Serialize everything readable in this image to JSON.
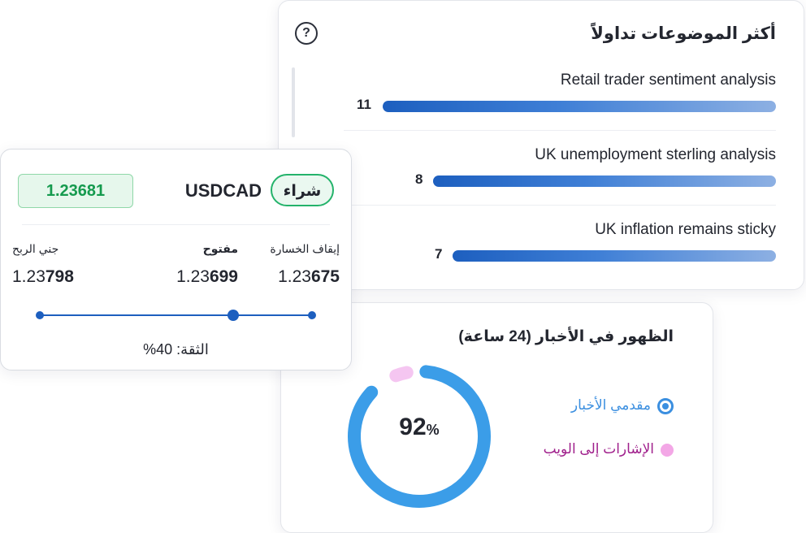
{
  "topics": {
    "title": "أكثر الموضوعات تداولاً",
    "help_glyph": "?",
    "items": [
      {
        "label": "Retail trader sentiment analysis",
        "count": "11",
        "value": 11
      },
      {
        "label": "UK unemployment sterling analysis",
        "count": "8",
        "value": 8
      },
      {
        "label": "UK inflation remains sticky",
        "count": "7",
        "value": 7
      }
    ]
  },
  "news": {
    "title": "الظهور في الأخبار (24 ساعة)",
    "percent": "92",
    "percent_symbol": "%",
    "percent_value": 92,
    "legend": [
      {
        "label": "مقدمي الأخبار",
        "color": "#3b8fe0"
      },
      {
        "label": "الإشارات إلى الويب",
        "color": "#a0208c",
        "dot_color": "#f3a7e6"
      }
    ]
  },
  "trade": {
    "action_label": "شراء",
    "pair": "USDCAD",
    "price": "1.23681",
    "stop_loss": {
      "label": "إيقاف الخسارة",
      "prefix": "1.23",
      "suffix": "675"
    },
    "open": {
      "label": "مفتوح",
      "prefix": "1.23",
      "suffix": "699"
    },
    "take_profit": {
      "label": "جني الربح",
      "prefix": "1.23",
      "suffix": "798"
    },
    "confidence_text": "الثقة: 40%",
    "confidence_value": 40
  },
  "colors": {
    "accent_blue": "#1d5fbf",
    "buy_green": "#24b36b",
    "donut_blue": "#3b8fe0",
    "donut_pink": "#f3c4f0"
  }
}
